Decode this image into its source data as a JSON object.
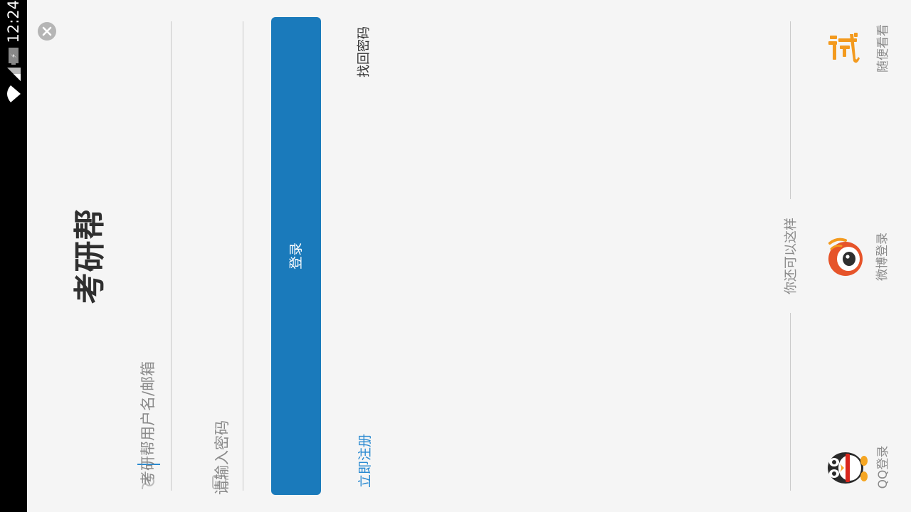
{
  "status_bar": {
    "time": "12:24",
    "icons": [
      "wifi-icon",
      "signal-icon",
      "battery-icon"
    ]
  },
  "header": {
    "close_icon": "close-icon",
    "app_name": "考研帮"
  },
  "form": {
    "username_placeholder": "考研帮用户名/邮箱",
    "password_placeholder": "请输入密码",
    "login_label": "登录",
    "forgot_password": "找回密码",
    "register": "立即注册"
  },
  "alternatives": {
    "heading": "你还可以这样",
    "items": [
      {
        "label": "随便看看",
        "icon": "try-icon"
      },
      {
        "label": "微博登录",
        "icon": "weibo-icon"
      },
      {
        "label": "QQ登录",
        "icon": "qq-icon"
      }
    ]
  },
  "colors": {
    "accent": "#1a7abb",
    "link": "#2a8ad1",
    "background": "#f5f5f5",
    "try_orange": "#f39a1e",
    "weibo_red": "#e6542a"
  }
}
